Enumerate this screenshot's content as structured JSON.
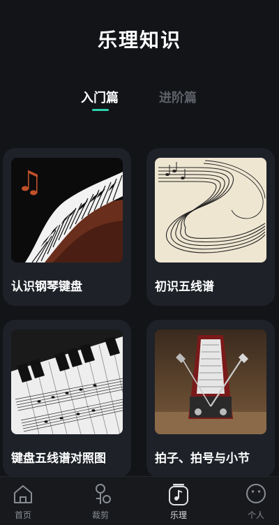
{
  "header": {
    "title": "乐理知识"
  },
  "tabs": [
    {
      "label": "入门篇",
      "active": true
    },
    {
      "label": "进阶篇",
      "active": false
    }
  ],
  "cards": [
    {
      "label": "认识钢琴键盘",
      "icon": "piano-keys-image"
    },
    {
      "label": "初识五线谱",
      "icon": "staff-lines-image"
    },
    {
      "label": "键盘五线谱对照图",
      "icon": "keyboard-staff-chart-image"
    },
    {
      "label": "拍子、拍号与小节",
      "icon": "metronome-image"
    }
  ],
  "bottom_nav": [
    {
      "label": "首页",
      "icon": "home-icon"
    },
    {
      "label": "裁剪",
      "icon": "scissors-icon"
    },
    {
      "label": "乐理",
      "icon": "music-note-icon",
      "active": true
    },
    {
      "label": "个人",
      "icon": "smiley-face-icon"
    }
  ],
  "colors": {
    "background": "#121418",
    "card": "#1e2228",
    "accent": "#2fd0b0"
  }
}
